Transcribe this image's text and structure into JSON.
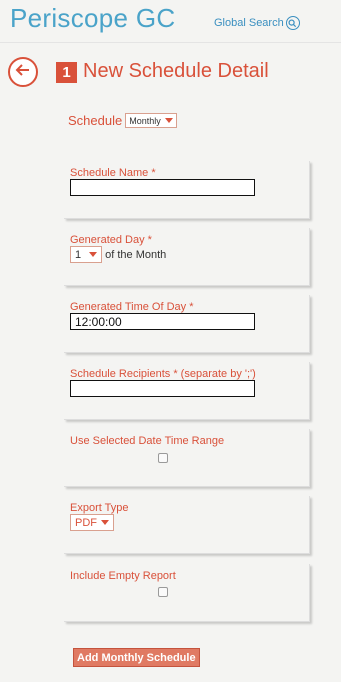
{
  "header": {
    "app_title": "Periscope GC",
    "global_search_label": "Global Search"
  },
  "page": {
    "step_number": "1",
    "title": "New Schedule Detail"
  },
  "schedule": {
    "label": "Schedule",
    "selected": "Monthly"
  },
  "fields": {
    "schedule_name": {
      "label": "Schedule Name *",
      "value": ""
    },
    "generated_day": {
      "label": "Generated Day *",
      "selected": "1",
      "suffix": "of the Month"
    },
    "generated_time": {
      "label": "Generated Time Of Day *",
      "value": "12:00:00"
    },
    "recipients": {
      "label": "Schedule Recipients * (separate by ';')",
      "value": ""
    },
    "use_date_range": {
      "label": "Use Selected Date Time Range",
      "checked": false
    },
    "export_type": {
      "label": "Export Type",
      "selected": "PDF"
    },
    "include_empty": {
      "label": "Include Empty Report",
      "checked": false
    }
  },
  "actions": {
    "add_button": "Add Monthly Schedule"
  },
  "colors": {
    "accent": "#d9513a",
    "brand": "#4aa3c9",
    "background": "#f4f4f2"
  }
}
